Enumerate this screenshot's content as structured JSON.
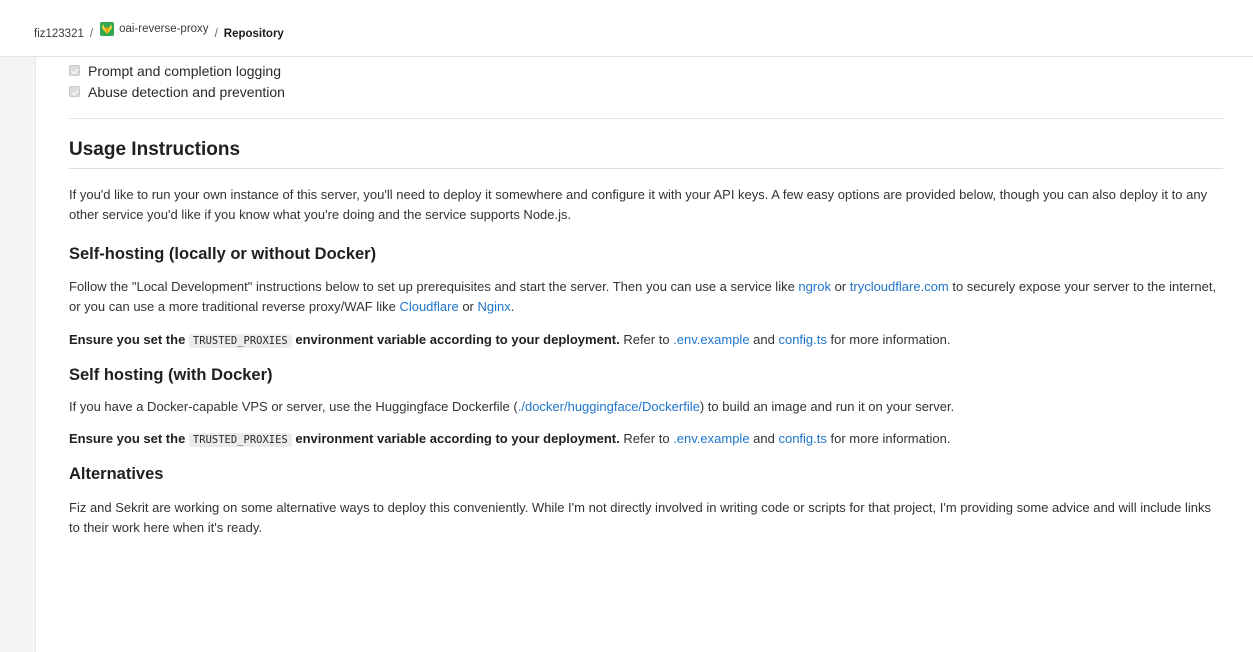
{
  "breadcrumb": {
    "user": "fiz123321",
    "separator": "/",
    "project": "oai-reverse-proxy",
    "current": "Repository"
  },
  "checklist": [
    "Prompt and completion logging",
    "Abuse detection and prevention"
  ],
  "usage": {
    "title": "Usage Instructions",
    "intro": "If you'd like to run your own instance of this server, you'll need to deploy it somewhere and configure it with your API keys. A few easy options are provided below, though you can also deploy it to any other service you'd like if you know what you're doing and the service supports Node.js."
  },
  "self_hosting": {
    "title": "Self-hosting (locally or without Docker)",
    "p1_a": "Follow the \"Local Development\" instructions below to set up prerequisites and start the server. Then you can use a service like ",
    "link_ngrok": "ngrok",
    "p1_b": " or ",
    "link_trycloudflare": "trycloudflare.com",
    "p1_c": " to securely expose your server to the internet, or you can use a more traditional reverse proxy/WAF like ",
    "link_cloudflare": "Cloudflare",
    "p1_d": " or ",
    "link_nginx": "Nginx",
    "p1_e": "."
  },
  "ensure": {
    "strong_a": "Ensure you set the ",
    "code": "TRUSTED_PROXIES",
    "strong_b": " environment variable according to your deployment.",
    "refer": " Refer to ",
    "link_env": ".env.example",
    "and": " and ",
    "link_config": "config.ts",
    "tail": " for more information."
  },
  "docker": {
    "title": "Self hosting (with Docker)",
    "p_a": "If you have a Docker-capable VPS or server, use the Huggingface Dockerfile (",
    "link_dockerfile": "./docker/huggingface/Dockerfile",
    "p_b": ") to build an image and run it on your server."
  },
  "alternatives": {
    "title": "Alternatives",
    "text": "Fiz and Sekrit are working on some alternative ways to deploy this conveniently. While I'm not directly involved in writing code or scripts for that project, I'm providing some advice and will include links to their work here when it's ready."
  },
  "colors": {
    "link": "#1f75cb",
    "text": "#333333",
    "heading": "#1f1f1f"
  },
  "icons": {
    "project_avatar": "tanuki-icon",
    "checkbox": "checked-checkbox-icon"
  }
}
